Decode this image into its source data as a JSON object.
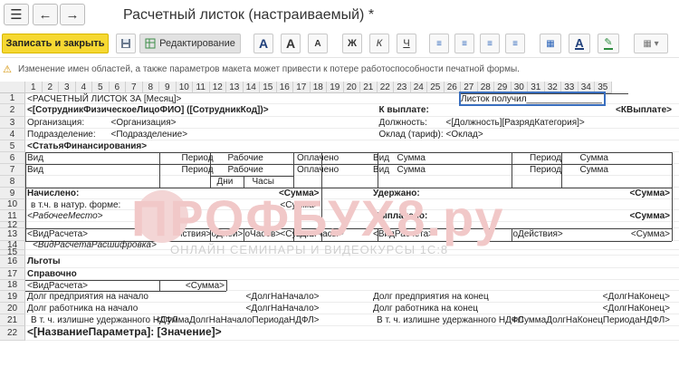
{
  "window": {
    "title": "Расчетный листок (настраиваемый) *",
    "nav": {
      "menu_icon": "hamburger-icon",
      "back_icon": "arrow-left-icon",
      "forward_icon": "arrow-right-icon"
    }
  },
  "toolbar": {
    "save_close": "Записать и закрыть",
    "save_icon": "floppy-icon",
    "edit_label": "Редактирование",
    "font_A": "A",
    "font_grow": "A",
    "font_shrink": "A",
    "bold": "Ж",
    "italic": "К",
    "underline": "Ч"
  },
  "warning": {
    "text": "Изменение имен областей, а также параметров макета может привести к потере работоспособности печатной формы."
  },
  "columns": [
    "1",
    "2",
    "3",
    "4",
    "5",
    "6",
    "7",
    "8",
    "9",
    "10",
    "11",
    "12",
    "13",
    "14",
    "15",
    "16",
    "17",
    "18",
    "19",
    "20",
    "21",
    "22",
    "23",
    "24",
    "25",
    "26",
    "27",
    "28",
    "29",
    "30",
    "31",
    "32",
    "33",
    "34",
    "35"
  ],
  "rows": [
    "1",
    "2",
    "3",
    "4",
    "5",
    "6",
    "7",
    "8",
    "9",
    "10",
    "11",
    "12",
    "13",
    "14",
    "15",
    "16",
    "17",
    "18",
    "19",
    "20",
    "21",
    "22"
  ],
  "sheet": {
    "r1_title": "<РАСЧЕТНЫЙ ЛИСТОК ЗА [Месяц]>",
    "r1_receipt": "Листок получил_______________",
    "r2_employee": "<[СотрудникФизическоеЛицоФИО] ([СотрудникКод])>",
    "r2_topay": "К выплате:",
    "r2_topay_val": "<КВыплате>",
    "r3_org_lbl": "Организация:",
    "r3_org": "<Организация>",
    "r3_pos_lbl": "Должность:",
    "r3_pos": "<[Должность][РазрядКатегория]>",
    "r4_dep_lbl": "Подразделение:",
    "r4_dep": "<Подразделение>",
    "r4_salary_lbl": "Оклад (тариф):",
    "r4_salary": "<Оклад>",
    "r5_article": "<СтатьяФинансирования>",
    "h_vid": "Вид",
    "h_period": "Период",
    "h_work": "Рабочие",
    "h_paid": "Оплачено",
    "h_sum": "Сумма",
    "h_days": "Дни",
    "h_hours": "Часы",
    "r9_accrued": "Начислено:",
    "r9_sum": "<Сумма>",
    "r9_withheld": "Удержано:",
    "r9_wsum": "<Сумма>",
    "r10_natural": "в т.ч. в натур. форме:",
    "r10_sum": "<Сумма>",
    "r11_workplace": "<РабочееМесто>",
    "r11_paid": "Выплачено:",
    "r11_psum": "<Сумма>",
    "r13_vidcalc": "<ВидРасчета>",
    "r13_action": "оДействия>",
    "r13_days": "оДней>",
    "r13_hours": "оЧасов>",
    "r13_daysp": "оДниЧасы>",
    "r13_sum": "<Сумма>",
    "r13_vidcalc2": "<ВидРасчета>",
    "r13_action2": "оДействия>",
    "r13_sum2": "<Сумма>",
    "r14_decode": "<ВидРасчетаРасшифровка>",
    "r16_benefits": "Льготы",
    "r17_reference": "Справочно",
    "r18_vid": "<ВидРасчета>",
    "r18_sum": "<Сумма>",
    "r19_debt_ent_start": "Долг предприятия на начало",
    "r19_val": "<ДолгНаНачало>",
    "r19_debt_ent_end": "Долг предприятия на конец",
    "r19_val2": "<ДолгНаКонец>",
    "r20_debt_emp_start": "Долг работника на начало",
    "r20_val": "<ДолгНаНачало>",
    "r20_debt_emp_end": "Долг работника на конец",
    "r20_val2": "<ДолгНаКонец>",
    "r21_ndfl": "В т. ч. излишне удержанного НДФЛ",
    "r21_val": "<СуммаДолгНаНачалоПериодаНДФЛ>",
    "r21_ndfl2": "В т. ч. излишне удержанного НДФЛ",
    "r21_val2": "<СуммаДолгНаКонецПериодаНДФЛ>",
    "r22_param": "<[НазваниеПараметра]: [Значение]>"
  },
  "watermark": {
    "brand": "ПРОФБУХ8.ру",
    "sub": "ОНЛАЙН СЕМИНАРЫ И ВИДЕОКУРСЫ 1С:8"
  }
}
